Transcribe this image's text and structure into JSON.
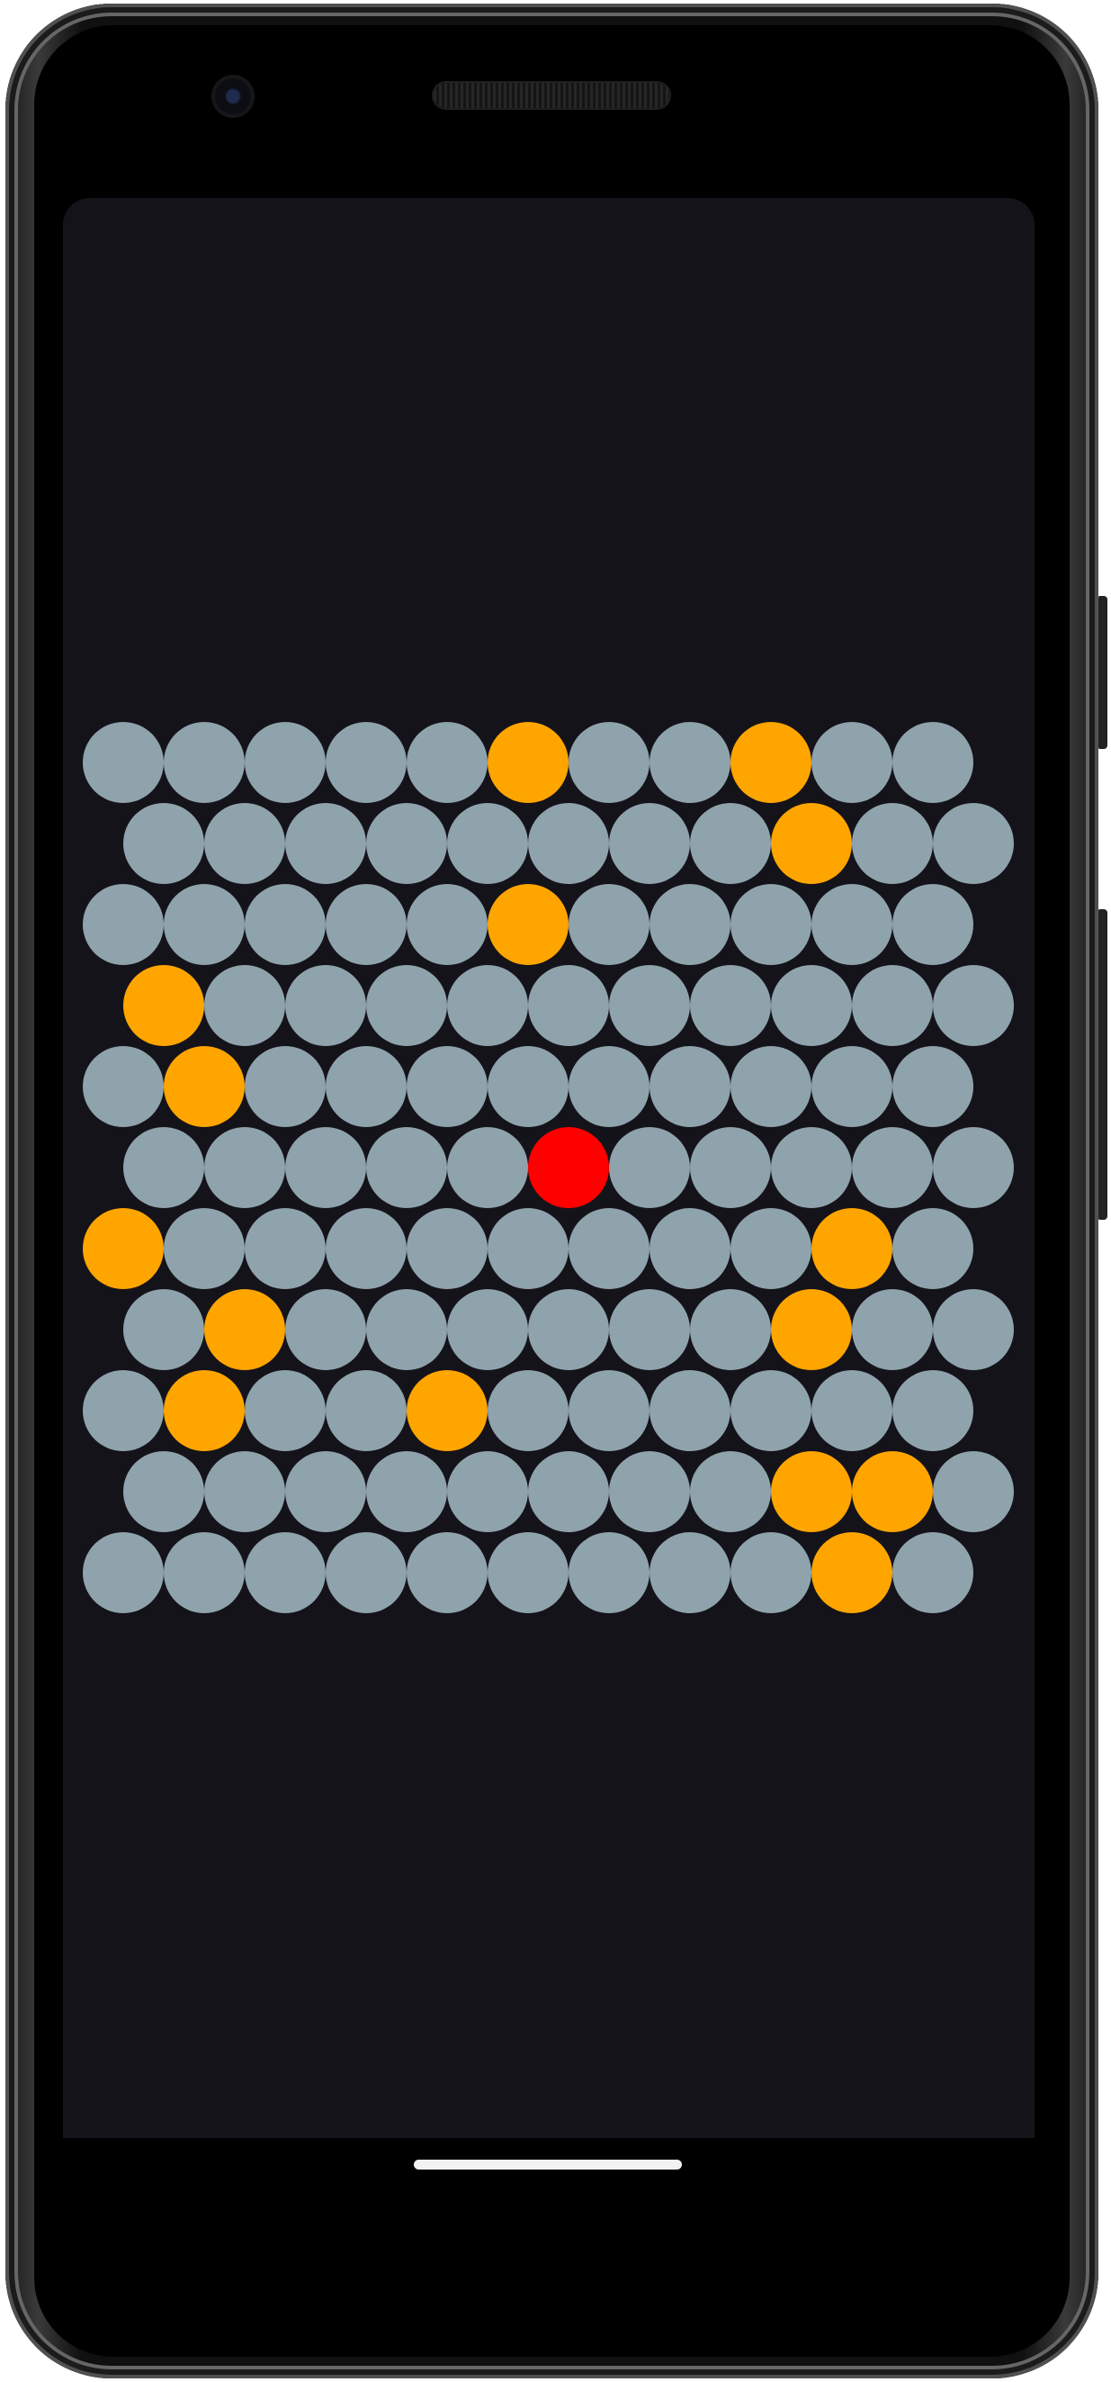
{
  "colors": {
    "device_frame": "#101010",
    "screen_background": "#15131a",
    "empty_circle": "#8fa3ad",
    "blocked_circle": "#ffa500",
    "cat_circle": "#ff0000",
    "home_indicator": "#f2f2f2"
  },
  "device": {
    "camera_icon": "front-camera-icon",
    "speaker_icon": "earpiece-speaker-icon",
    "home_indicator_icon": "gesture-home-indicator"
  },
  "game": {
    "rows": 11,
    "columns": 11,
    "grid": [
      [
        "empty",
        "empty",
        "empty",
        "empty",
        "empty",
        "blocked",
        "empty",
        "empty",
        "blocked",
        "empty",
        "empty"
      ],
      [
        "empty",
        "empty",
        "empty",
        "empty",
        "empty",
        "empty",
        "empty",
        "empty",
        "blocked",
        "empty",
        "empty"
      ],
      [
        "empty",
        "empty",
        "empty",
        "empty",
        "empty",
        "blocked",
        "empty",
        "empty",
        "empty",
        "empty",
        "empty"
      ],
      [
        "blocked",
        "empty",
        "empty",
        "empty",
        "empty",
        "empty",
        "empty",
        "empty",
        "empty",
        "empty",
        "empty"
      ],
      [
        "empty",
        "blocked",
        "empty",
        "empty",
        "empty",
        "empty",
        "empty",
        "empty",
        "empty",
        "empty",
        "empty"
      ],
      [
        "empty",
        "empty",
        "empty",
        "empty",
        "empty",
        "cat",
        "empty",
        "empty",
        "empty",
        "empty",
        "empty"
      ],
      [
        "blocked",
        "empty",
        "empty",
        "empty",
        "empty",
        "empty",
        "empty",
        "empty",
        "empty",
        "blocked",
        "empty"
      ],
      [
        "empty",
        "blocked",
        "empty",
        "empty",
        "empty",
        "empty",
        "empty",
        "empty",
        "blocked",
        "empty",
        "empty"
      ],
      [
        "empty",
        "blocked",
        "empty",
        "empty",
        "blocked",
        "empty",
        "empty",
        "empty",
        "empty",
        "empty",
        "empty"
      ],
      [
        "empty",
        "empty",
        "empty",
        "empty",
        "empty",
        "empty",
        "empty",
        "empty",
        "blocked",
        "blocked",
        "empty"
      ],
      [
        "empty",
        "empty",
        "empty",
        "empty",
        "empty",
        "empty",
        "empty",
        "empty",
        "empty",
        "blocked",
        "empty"
      ]
    ]
  }
}
